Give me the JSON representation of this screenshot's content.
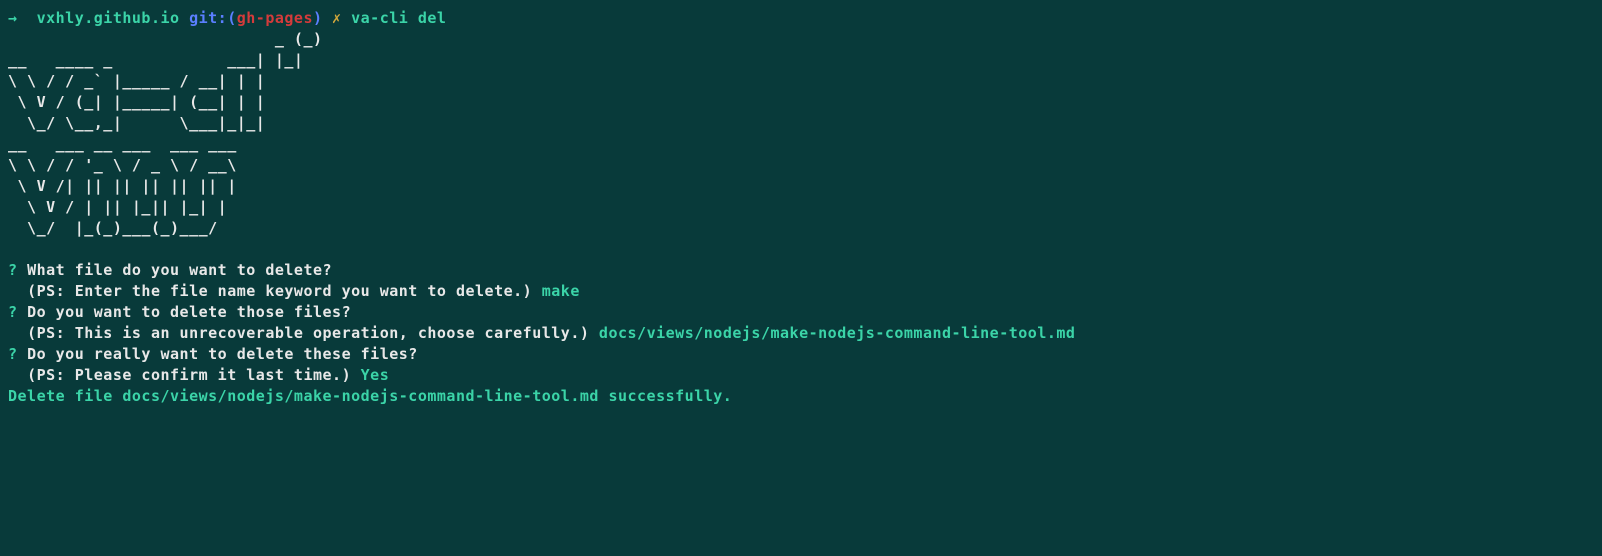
{
  "prompt": {
    "arrow": "→  ",
    "cwd": "vxhly.github.io",
    "git_label": "git:(",
    "git_branch": "gh-pages",
    "git_close": ")",
    "prompt_x": " ✗ ",
    "command": "va-cli del"
  },
  "ascii_art": "                            _ (_)\n__   ____ _            ___| |_|\n\\ \\ / / _` |_____ / __| | |\n \\ V / (_| |_____| (__| | |\n  \\_/ \\__,_|      \\___|_|_|\n__   ___ __ ___  ___ ___\n\\ \\ / / '_ \\ / _ \\ / __\\\n \\ V /| || || || || || |\n  \\ V / | || |_|| |_| |\n  \\_/  |_(_)___(_)___/",
  "questions": {
    "q1": "What file do you want to delete?",
    "h1": "(PS: Enter the file name keyword you want to delete.)",
    "a1": "make",
    "q2": "Do you want to delete those files?",
    "h2": "(PS: This is an unrecoverable operation, choose carefully.)",
    "a2": "docs/views/nodejs/make-nodejs-command-line-tool.md",
    "q3": "Do you really want to delete these files?",
    "h3": "(PS: Please confirm it last time.)",
    "a3": "Yes"
  },
  "result": "Delete file docs/views/nodejs/make-nodejs-command-line-tool.md successfully."
}
